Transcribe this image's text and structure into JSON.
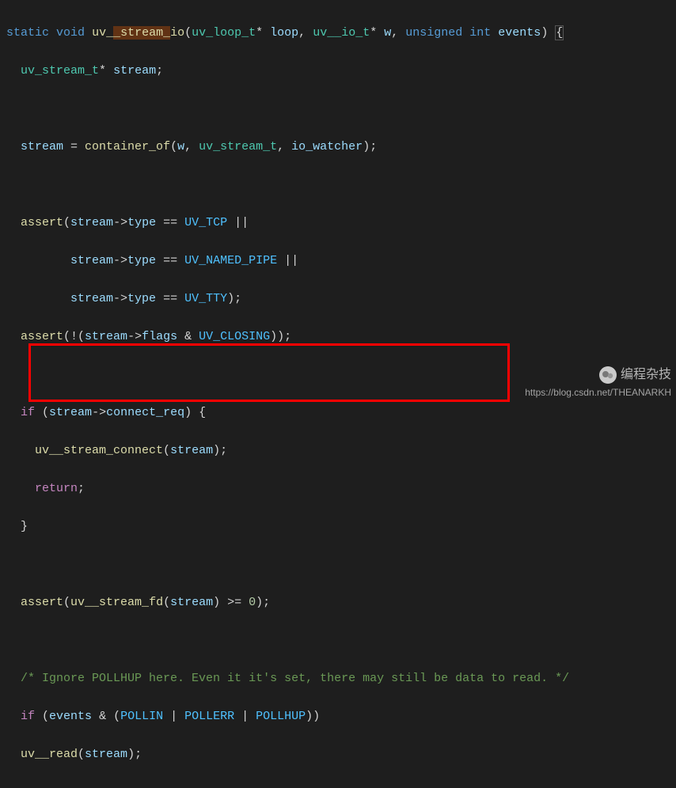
{
  "code": {
    "l1_static": "static",
    "l1_void": "void",
    "l1_fn": "uv__stream_io",
    "l1_p": "(",
    "l1_t1": "uv_loop_t",
    "l1_s1": "* ",
    "l1_v1": "loop",
    "l1_c1": ", ",
    "l1_t2": "uv__io_t",
    "l1_s2": "* ",
    "l1_v2": "w",
    "l1_c2": ", ",
    "l1_kw3": "unsigned",
    "l1_kw4": " int",
    "l1_sp": " ",
    "l1_v3": "events",
    "l1_e": ") ",
    "l1_brace": "{",
    "l2_t": "uv_stream_t",
    "l2_s": "* ",
    "l2_v": "stream",
    "l2_e": ";",
    "l4_v1": "stream",
    "l4_eq": " = ",
    "l4_fn": "container_of",
    "l4_p": "(",
    "l4_v2": "w",
    "l4_c1": ", ",
    "l4_t": "uv_stream_t",
    "l4_c2": ", ",
    "l4_v3": "io_watcher",
    "l4_e": ");",
    "l6_fn": "assert",
    "l6_p": "(",
    "l6_v": "stream",
    "l6_arrow": "->",
    "l6_m": "type",
    "l6_eq": " == ",
    "l6_c": "UV_TCP",
    "l6_or": " ||",
    "l7_v": "stream",
    "l7_arrow": "->",
    "l7_m": "type",
    "l7_eq": " == ",
    "l7_c": "UV_NAMED_PIPE",
    "l7_or": " ||",
    "l8_v": "stream",
    "l8_arrow": "->",
    "l8_m": "type",
    "l8_eq": " == ",
    "l8_c": "UV_TTY",
    "l8_e": ");",
    "l9_fn": "assert",
    "l9_p": "(!(",
    "l9_v": "stream",
    "l9_arrow": "->",
    "l9_m": "flags",
    "l9_amp": " & ",
    "l9_c": "UV_CLOSING",
    "l9_e": "));",
    "l11_if": "if",
    "l11_p": " (",
    "l11_v": "stream",
    "l11_arrow": "->",
    "l11_m": "connect_req",
    "l11_e": ") {",
    "l12_fn": "uv__stream_connect",
    "l12_p": "(",
    "l12_v": "stream",
    "l12_e": ");",
    "l13_ret": "return",
    "l13_e": ";",
    "l14": "}",
    "l16_fn": "assert",
    "l16_p": "(",
    "l16_fn2": "uv__stream_fd",
    "l16_p2": "(",
    "l16_v": "stream",
    "l16_p3": ") >= ",
    "l16_n": "0",
    "l16_e": ");",
    "l18": "/* Ignore POLLHUP here. Even it it's set, there may still be data to read. */",
    "l19_if": "if",
    "l19_p": " (",
    "l19_v": "events",
    "l19_amp": " & (",
    "l19_c1": "POLLIN",
    "l19_or1": " | ",
    "l19_c2": "POLLERR",
    "l19_or2": " | ",
    "l19_c3": "POLLHUP",
    "l19_e": "))",
    "l20_fn": "uv__read",
    "l20_p": "(",
    "l20_v": "stream",
    "l20_e": ");"
  },
  "watermark": {
    "title": "编程杂技",
    "url": "https://blog.csdn.net/THEANARKH"
  }
}
